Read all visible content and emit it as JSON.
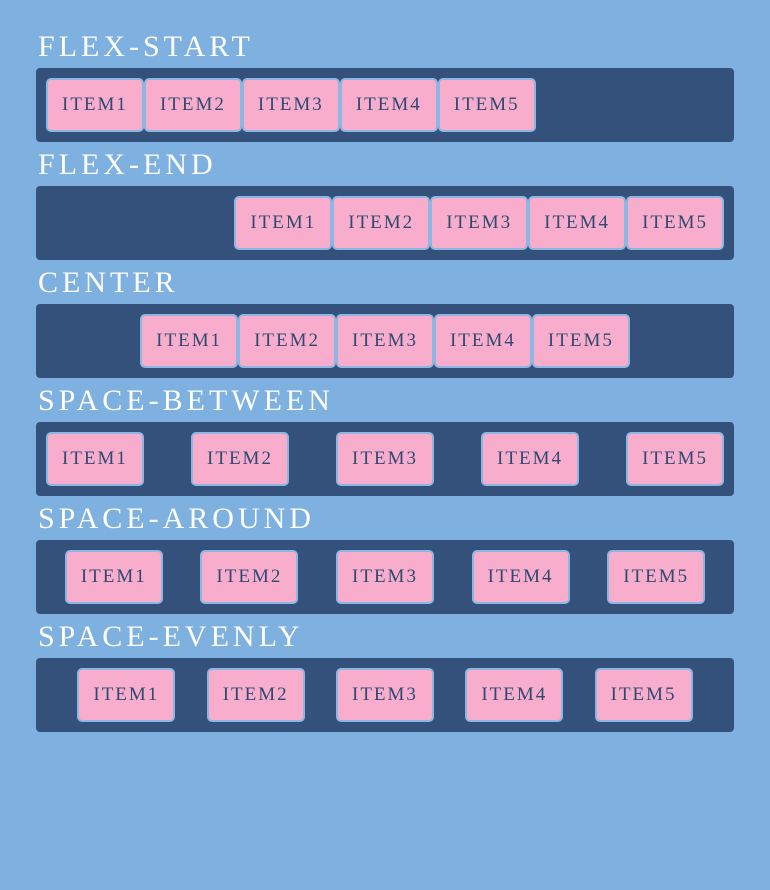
{
  "sections": [
    {
      "title": "flex-start",
      "class": "flex-start",
      "items": [
        "Item1",
        "Item2",
        "Item3",
        "Item4",
        "Item5"
      ]
    },
    {
      "title": "flex-end",
      "class": "flex-end",
      "items": [
        "Item1",
        "Item2",
        "Item3",
        "Item4",
        "Item5"
      ]
    },
    {
      "title": "center",
      "class": "center",
      "items": [
        "Item1",
        "Item2",
        "Item3",
        "Item4",
        "Item5"
      ]
    },
    {
      "title": "space-between",
      "class": "space-between",
      "items": [
        "Item1",
        "Item2",
        "Item3",
        "Item4",
        "Item5"
      ]
    },
    {
      "title": "space-around",
      "class": "space-around",
      "items": [
        "Item1",
        "Item2",
        "Item3",
        "Item4",
        "Item5"
      ]
    },
    {
      "title": "space-evenly",
      "class": "space-evenly",
      "items": [
        "Item1",
        "Item2",
        "Item3",
        "Item4",
        "Item5"
      ]
    }
  ]
}
